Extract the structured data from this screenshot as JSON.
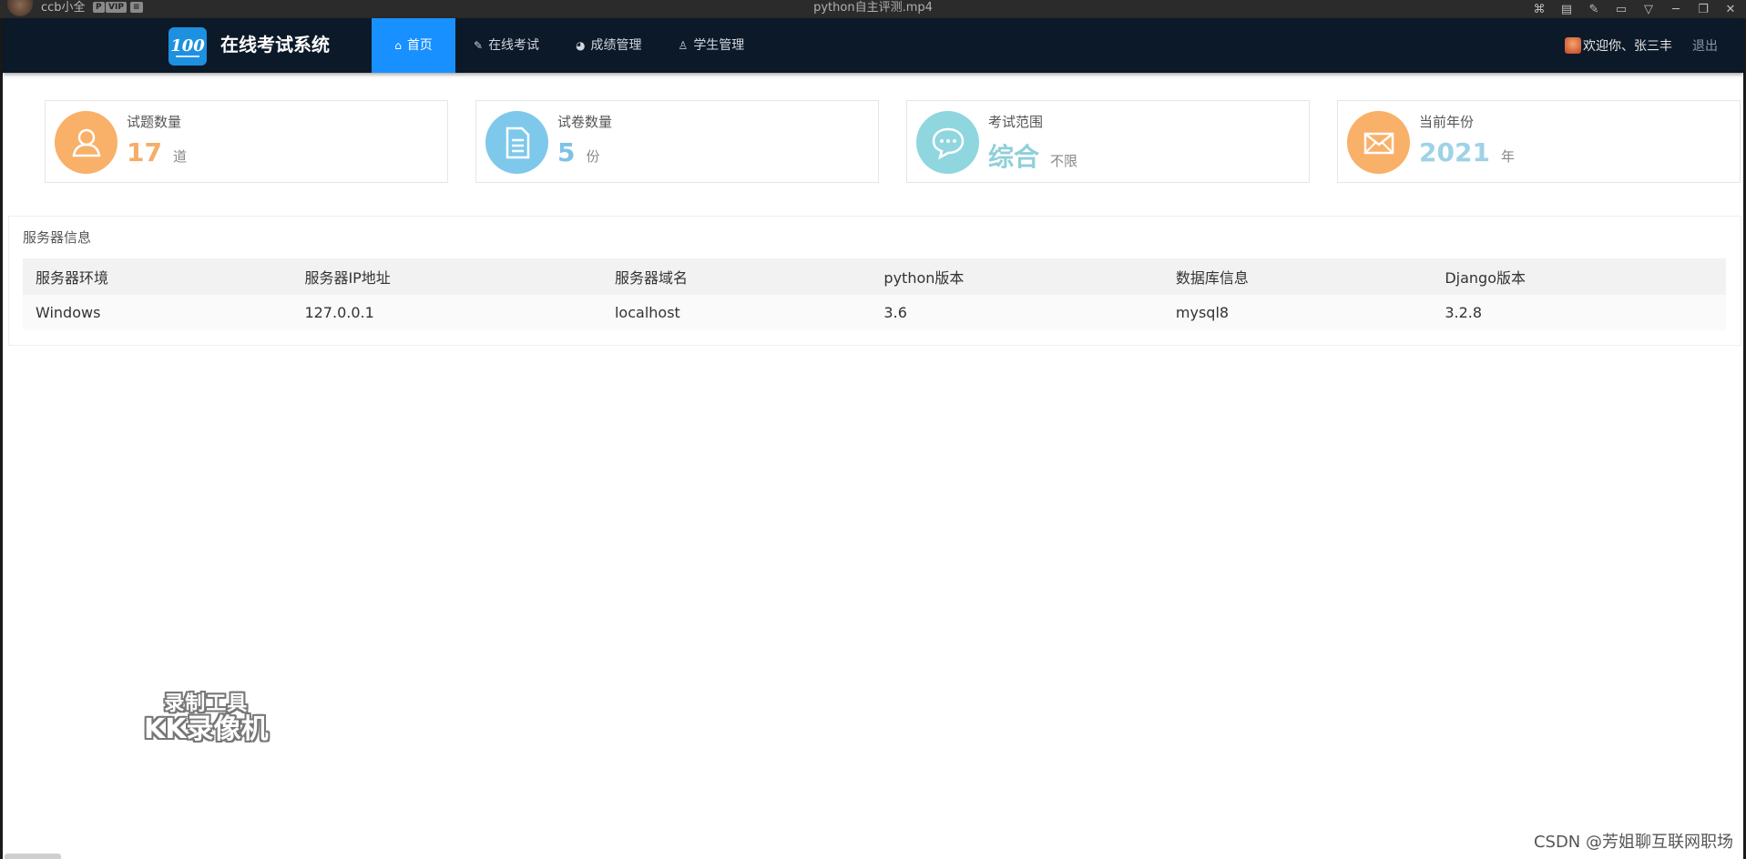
{
  "player": {
    "user": "ccb小全",
    "badge_p": "P",
    "badge_vip": "VIP",
    "title": "python自主评测.mp4"
  },
  "navbar": {
    "brand": "在线考试系统",
    "logo_text": "100",
    "items": [
      {
        "label": "首页",
        "icon": "home-icon",
        "active": true
      },
      {
        "label": "在线考试",
        "icon": "edit-icon",
        "active": false
      },
      {
        "label": "成绩管理",
        "icon": "chart-icon",
        "active": false
      },
      {
        "label": "学生管理",
        "icon": "user-icon",
        "active": false
      }
    ],
    "greeting": "欢迎你、张三丰",
    "logout": "退出"
  },
  "stats": [
    {
      "label": "试题数量",
      "value": "17",
      "unit": "道",
      "icon": "user-icon",
      "color": "#f9b068",
      "value_color": "#f5ad68"
    },
    {
      "label": "试卷数量",
      "value": "5",
      "unit": "份",
      "icon": "document-icon",
      "color": "#7ec8ec",
      "value_color": "#7ec3e6"
    },
    {
      "label": "考试范围",
      "value": "综合",
      "unit": "不限",
      "icon": "chat-icon",
      "color": "#8fd6df",
      "value_color": "#8fcfd8"
    },
    {
      "label": "当前年份",
      "value": "2021",
      "unit": "年",
      "icon": "mail-icon",
      "color": "#f9b068",
      "value_color": "#9ed2e6"
    }
  ],
  "server": {
    "title": "服务器信息",
    "headers": [
      "服务器环境",
      "服务器IP地址",
      "服务器域名",
      "python版本",
      "数据库信息",
      "Django版本"
    ],
    "row": [
      "Windows",
      "127.0.0.1",
      "localhost",
      "3.6",
      "mysql8",
      "3.2.8"
    ]
  },
  "watermark": {
    "line1": "录制工具",
    "line2": "KK录像机"
  },
  "csdn": "CSDN @芳姐聊互联网职场"
}
